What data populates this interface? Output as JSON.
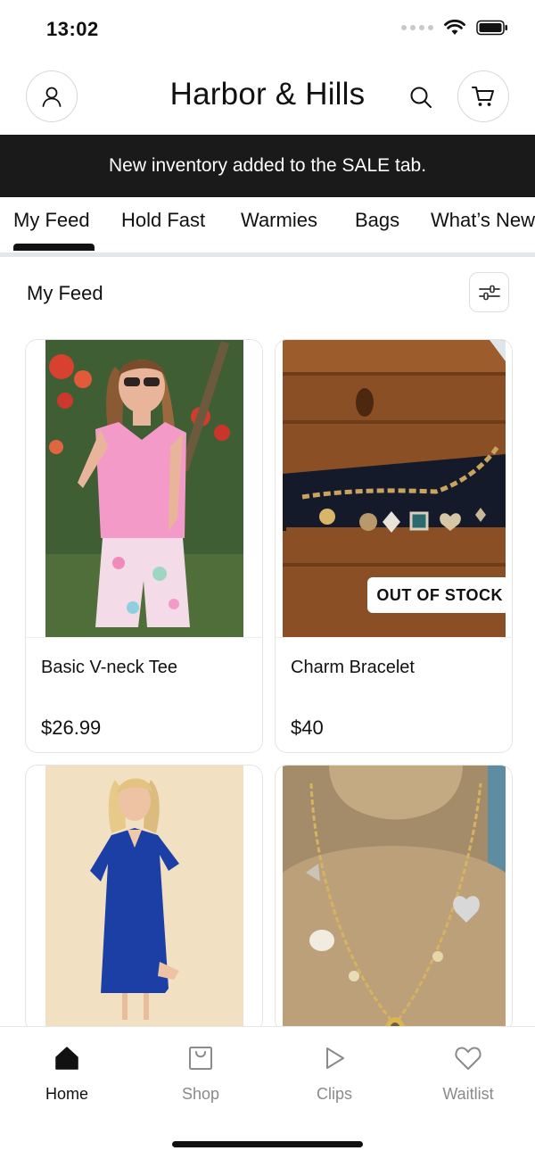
{
  "status_bar": {
    "time": "13:02"
  },
  "header": {
    "title": "Harbor & Hills"
  },
  "banner": {
    "text": "New inventory added to the SALE tab."
  },
  "tabs": [
    {
      "label": "My Feed",
      "active": true
    },
    {
      "label": "Hold Fast"
    },
    {
      "label": "Warmies"
    },
    {
      "label": "Bags"
    },
    {
      "label": "What’s New"
    }
  ],
  "feed": {
    "title": "My Feed",
    "products": [
      {
        "name": "Basic V-neck Tee",
        "price": "$26.99",
        "image": "woman in pink v-neck tee and floral shorts"
      },
      {
        "name": "Charm Bracelet",
        "price": "$40",
        "badge": "OUT OF STOCK",
        "image": "gold charm bracelet on wooden surface"
      },
      {
        "name": "",
        "price": "",
        "image": "woman in blue collared maxi dress"
      },
      {
        "name": "",
        "price": "",
        "image": "gold charm necklace on burlap bust"
      }
    ]
  },
  "bottom_nav": [
    {
      "label": "Home",
      "icon": "home-icon",
      "active": true
    },
    {
      "label": "Shop",
      "icon": "shopping-bag-icon"
    },
    {
      "label": "Clips",
      "icon": "play-icon"
    },
    {
      "label": "Waitlist",
      "icon": "heart-icon"
    }
  ],
  "colors": {
    "banner_bg": "#1a1a1a",
    "accent": "#111111",
    "inactive": "#8a8a8a"
  }
}
